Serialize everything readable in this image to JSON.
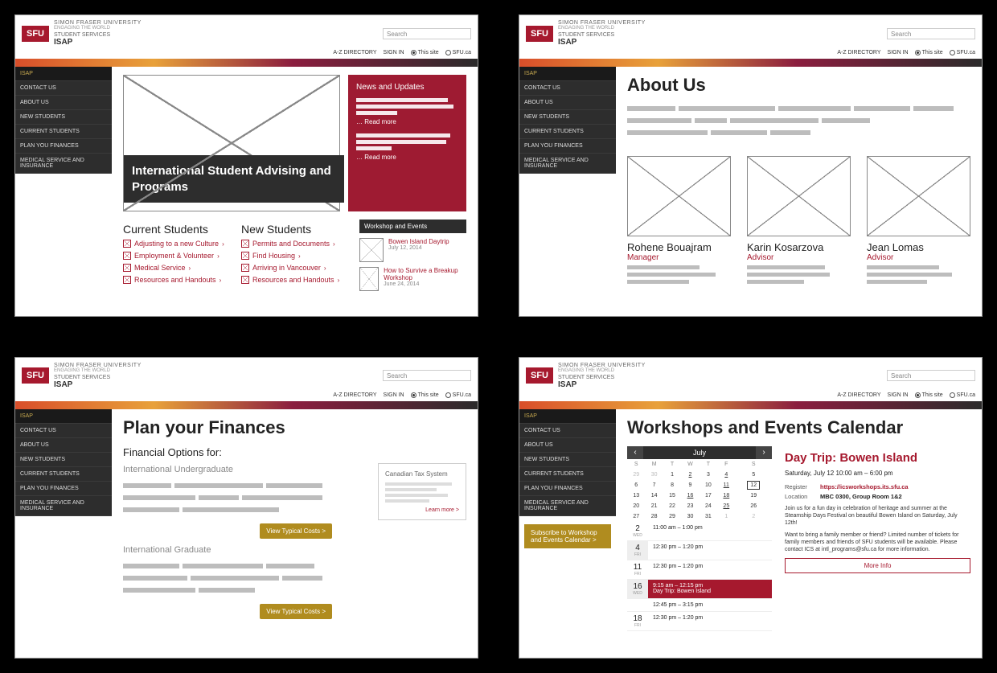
{
  "header": {
    "logo": "SFU",
    "university": "SIMON FRASER UNIVERSITY",
    "tagline": "ENGAGING THE WORLD",
    "dept": "STUDENT SERVICES",
    "unit": "ISAP",
    "search_placeholder": "Search",
    "az": "A-Z DIRECTORY",
    "signin": "SIGN IN",
    "radio_this": "This site",
    "radio_sfu": "SFU.ca"
  },
  "sidenav": {
    "top": "ISAP",
    "items": [
      "CONTACT US",
      "ABOUT US",
      "NEW STUDENTS",
      "CURRENT STUDENTS",
      "PLAN YOU FINANCES",
      "MEDICAL SERVICE AND INSURANCE"
    ]
  },
  "screen1": {
    "hero_title": "International Student Advising and Programs",
    "news_header": "News and Updates",
    "read_more": "… Read more",
    "col_current": "Current Students",
    "col_new": "New Students",
    "current_links": [
      "Adjusting to a new Culture",
      "Employment & Volunteer",
      "Medical Service",
      "Resources and Handouts"
    ],
    "new_links": [
      "Permits and Documents",
      "Find Housing",
      "Arriving in Vancouver",
      "Resources and Handouts"
    ],
    "we_header": "Workshop and Events",
    "we": [
      {
        "t": "Bowen Island Daytrip",
        "d": "July 12, 2014"
      },
      {
        "t": "How to Survive a Breakup Workshop",
        "d": "June 24, 2014"
      }
    ]
  },
  "screen2": {
    "title": "About Us",
    "staff": [
      {
        "name": "Rohene Bouajram",
        "role": "Manager"
      },
      {
        "name": "Karin Kosarzova",
        "role": "Advisor"
      },
      {
        "name": "Jean Lomas",
        "role": "Advisor"
      }
    ]
  },
  "screen3": {
    "title": "Plan your Finances",
    "subtitle": "Financial Options for:",
    "group1": "International Undergraduate",
    "group2": "International Graduate",
    "taxbox_title": "Canadian Tax System",
    "learn_more": "Learn more >",
    "cta": "View Typical Costs >"
  },
  "screen4": {
    "title": "Workshops and Events Calendar",
    "subscribe": "Subscribe to Workshop and Events Calendar >",
    "month": "July",
    "dow": [
      "S",
      "M",
      "T",
      "W",
      "T",
      "F",
      "S"
    ],
    "weeks": [
      [
        {
          "n": "29",
          "o": 1
        },
        {
          "n": "30",
          "o": 1
        },
        {
          "n": "1"
        },
        {
          "n": "2",
          "u": 1
        },
        {
          "n": "3"
        },
        {
          "n": "4",
          "u": 1
        },
        {
          "n": "5"
        }
      ],
      [
        {
          "n": "6"
        },
        {
          "n": "7"
        },
        {
          "n": "8"
        },
        {
          "n": "9"
        },
        {
          "n": "10"
        },
        {
          "n": "11",
          "u": 1
        },
        {
          "n": "12",
          "t": 1
        }
      ],
      [
        {
          "n": "13"
        },
        {
          "n": "14"
        },
        {
          "n": "15"
        },
        {
          "n": "16",
          "u": 1
        },
        {
          "n": "17"
        },
        {
          "n": "18",
          "u": 1
        },
        {
          "n": "19"
        }
      ],
      [
        {
          "n": "20"
        },
        {
          "n": "21"
        },
        {
          "n": "22"
        },
        {
          "n": "23"
        },
        {
          "n": "24"
        },
        {
          "n": "25",
          "u": 1
        },
        {
          "n": "26"
        }
      ],
      [
        {
          "n": "27"
        },
        {
          "n": "28"
        },
        {
          "n": "29"
        },
        {
          "n": "30"
        },
        {
          "n": "31"
        },
        {
          "n": "1",
          "o": 1
        },
        {
          "n": "2",
          "o": 1
        }
      ]
    ],
    "daylist": [
      {
        "d": "2",
        "m": "WED",
        "e": "11:00 am – 1:00 pm"
      },
      {
        "d": "4",
        "m": "FRI",
        "e": "12:30 pm – 1:20 pm",
        "alt": 1
      },
      {
        "d": "11",
        "m": "FRI",
        "e": "12:30 pm – 1:20 pm"
      },
      {
        "d": "16",
        "m": "WED",
        "e": "9:15 am – 12:15 pm\nDay Trip: Bowen Island",
        "sel": 1,
        "e2": "12:45 pm – 3:15 pm"
      },
      {
        "d": "18",
        "m": "FRI",
        "e": "12:30 pm – 1:20 pm"
      }
    ],
    "event": {
      "title": "Day Trip: Bowen Island",
      "when": "Saturday, July 12 10:00 am – 6:00 pm",
      "register_k": "Register",
      "register_v": "https://icsworkshops.its.sfu.ca",
      "location_k": "Location",
      "location_v": "MBC 0300, Group Room 1&2",
      "p1": "Join us for a fun day in celebration of heritage and summer at the Steamship Days Festival on beautiful Bowen Island on Saturday, July 12th!",
      "p2": "Want to bring a family member or friend? Limited number of tickets for family members and friends of SFU students will be available. Please contact ICS at intl_programs@sfu.ca for more information.",
      "more": "More Info"
    }
  }
}
